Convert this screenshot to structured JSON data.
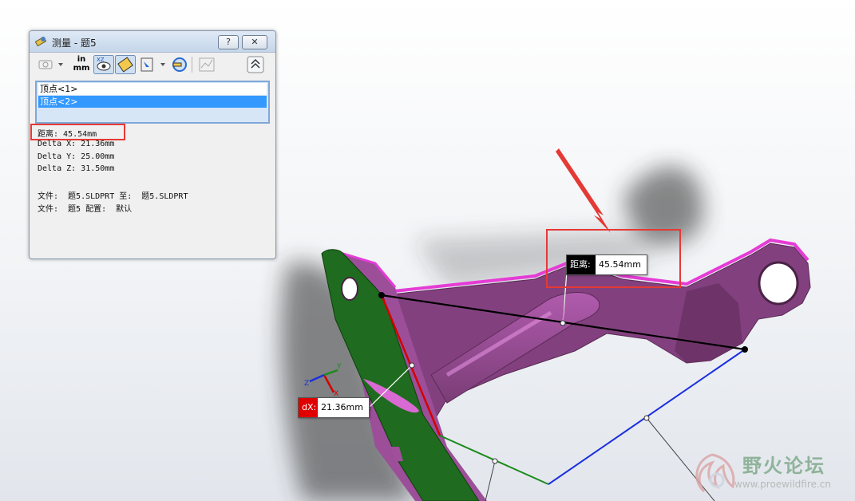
{
  "dialog": {
    "title": "测量 - 题5",
    "help_label": "?",
    "close_label": "✕",
    "toolbar": {
      "units_icon_top": "in",
      "units_icon_bottom": "mm",
      "icons": [
        "arc-circle-options-icon",
        "units-precision-icon",
        "show-xyz-icon",
        "point-to-point-icon",
        "projection-icon",
        "coordinate-system-icon",
        "history-icon",
        "collapse-icon"
      ]
    },
    "selections": [
      "顶点<1>",
      "顶点<2>"
    ],
    "results": {
      "distance": "距离: 45.54mm",
      "delta_x": "Delta X: 21.36mm",
      "delta_y": "Delta Y: 25.00mm",
      "delta_z": "Delta Z: 31.50mm",
      "file_line1": "文件:  题5.SLDPRT 至:  题5.SLDPRT",
      "file_line2": "文件:  题5 配置:  默认"
    }
  },
  "callouts": {
    "distance_tag": "距离:",
    "distance_value": "45.54mm",
    "dx_tag": "dX:",
    "dx_value": "21.36mm"
  },
  "triad": {
    "x": "X",
    "y": "Y",
    "z": "Z"
  },
  "watermark": {
    "name": "野火论坛",
    "url": "www.proewildfire.cn"
  },
  "colors": {
    "part_face": "#7e3f7a",
    "part_edge": "#e53cd6",
    "selected_face": "#1f6b1f",
    "annotation_red": "#e53935",
    "delta_x_line": "#d40000",
    "delta_y_line": "#1a8a1a",
    "delta_z_line": "#1a2fe0"
  }
}
